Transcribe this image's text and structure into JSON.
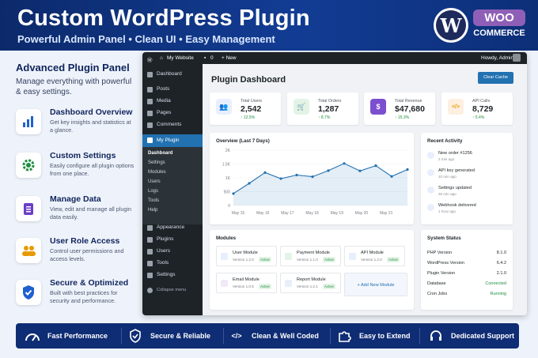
{
  "hero": {
    "title": "Custom WordPress Plugin",
    "subtitle": "Powerful Admin Panel • Clean UI • Easy Management",
    "wp_logo": "W",
    "woo_top": "WOO",
    "woo_bottom": "COMMERCE"
  },
  "left": {
    "heading": "Advanced Plugin Panel",
    "sub": "Manage everything with powerful & easy settings.",
    "features": [
      {
        "title": "Dashboard Overview",
        "desc": "Get key insights and statistics at a glance.",
        "icon": "bar-chart-icon"
      },
      {
        "title": "Custom Settings",
        "desc": "Easily configure all plugin options from one place.",
        "icon": "gear-icon"
      },
      {
        "title": "Manage Data",
        "desc": "View, edit and manage all plugin data easily.",
        "icon": "clipboard-icon"
      },
      {
        "title": "User Role Access",
        "desc": "Control user permissions and access levels.",
        "icon": "users-icon"
      },
      {
        "title": "Secure & Optimized",
        "desc": "Built with best practices for security and performance.",
        "icon": "shield-check-icon"
      }
    ]
  },
  "topbar": {
    "site": "My Website",
    "comments": "0",
    "new": "+ New",
    "howdy": "Howdy, Admin"
  },
  "sidebar": {
    "items": [
      "Dashboard",
      "Posts",
      "Media",
      "Pages",
      "Comments",
      "My Plugin",
      "Appearance",
      "Plugins",
      "Users",
      "Tools",
      "Settings"
    ],
    "submenu": [
      "Dashboard",
      "Settings",
      "Modules",
      "Users",
      "Logs",
      "Tools",
      "Help"
    ],
    "collapse": "Collapse menu"
  },
  "main": {
    "title": "Plugin Dashboard",
    "clear_cache": "Clear Cache",
    "stats": [
      {
        "label": "Total Users",
        "value": "2,542",
        "change": "↑ 12.5%",
        "glyph": "👥"
      },
      {
        "label": "Total Orders",
        "value": "1,287",
        "change": "↑ 8.7%",
        "glyph": "🛒"
      },
      {
        "label": "Total Revenue",
        "value": "$47,680",
        "change": "↑ 15.3%",
        "glyph": "$"
      },
      {
        "label": "API Calls",
        "value": "8,729",
        "change": "↑ 5.4%",
        "glyph": "</>"
      }
    ],
    "overview_title": "Overview (Last 7 Days)",
    "modules_title": "Modules",
    "modules": [
      {
        "name": "User Module",
        "version": "Version 1.2.0",
        "status": "Active",
        "color": "#2271b1"
      },
      {
        "name": "Payment Module",
        "version": "Version 1.1.0",
        "status": "Active",
        "color": "#1e8e3e"
      },
      {
        "name": "API Module",
        "version": "Version 1.2.0",
        "status": "Active",
        "color": "#2271b1"
      },
      {
        "name": "Email Module",
        "version": "Version 1.0.5",
        "status": "Active",
        "color": "#8f5fb7"
      },
      {
        "name": "Report Module",
        "version": "Version 1.2.1",
        "status": "Active",
        "color": "#2271b1"
      }
    ],
    "add_module": "+ Add New Module",
    "activity_title": "Recent Activity",
    "activity": [
      {
        "text": "New order #1256",
        "time": "2 min ago"
      },
      {
        "text": "API key generated",
        "time": "10 min ago"
      },
      {
        "text": "Settings updated",
        "time": "25 min ago"
      },
      {
        "text": "Webhook delivered",
        "time": "1 hour ago"
      }
    ],
    "system_title": "System Status",
    "system": [
      {
        "k": "PHP Version",
        "v": "8.1.0"
      },
      {
        "k": "WordPress Version",
        "v": "6.4.2"
      },
      {
        "k": "Plugin Version",
        "v": "2.1.0"
      },
      {
        "k": "Database",
        "v": "Connected"
      },
      {
        "k": "Cron Jobs",
        "v": "Running"
      }
    ]
  },
  "chart_data": {
    "type": "line",
    "x": [
      "May 15",
      "May 16",
      "May 17",
      "May 18",
      "May 19",
      "May 20",
      "May 21"
    ],
    "points": [
      [
        0,
        430
      ],
      [
        1,
        800
      ],
      [
        2,
        1190
      ],
      [
        3,
        970
      ],
      [
        4,
        1100
      ],
      [
        5,
        1040
      ],
      [
        6,
        1260
      ],
      [
        7,
        1520
      ],
      [
        8,
        1250
      ],
      [
        9,
        1440
      ],
      [
        10,
        1050
      ],
      [
        11,
        1300
      ]
    ],
    "y_ticks": [
      "2K",
      "1.5K",
      "1K",
      "500",
      "0"
    ],
    "ylim": [
      0,
      2000
    ],
    "color": "#2271b1"
  },
  "bottom": [
    "Fast Performance",
    "Secure & Reliable",
    "Clean & Well Coded",
    "Easy to Extend",
    "Dedicated Support"
  ]
}
